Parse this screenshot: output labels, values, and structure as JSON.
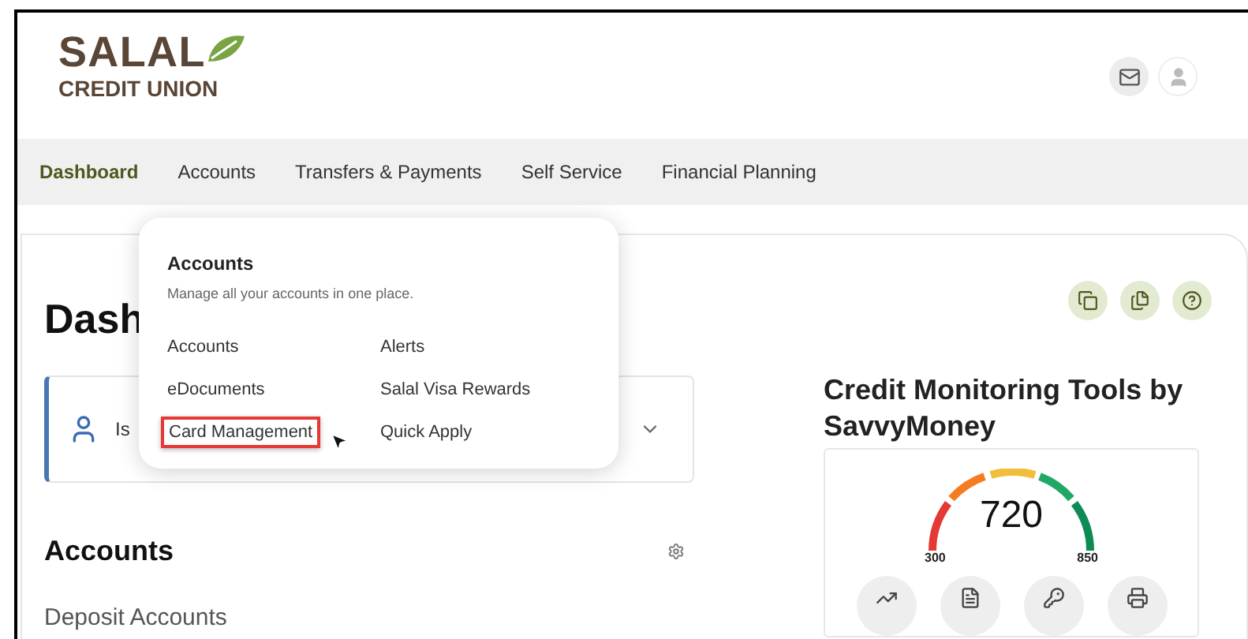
{
  "logo": {
    "name": "SALAL",
    "subtitle": "CREDIT UNION"
  },
  "nav": [
    {
      "label": "Dashboard",
      "selected": true
    },
    {
      "label": "Accounts",
      "selected": false
    },
    {
      "label": "Transfers & Payments",
      "selected": false
    },
    {
      "label": "Self Service",
      "selected": false
    },
    {
      "label": "Financial Planning",
      "selected": false
    }
  ],
  "dropdown": {
    "title": "Accounts",
    "description": "Manage all your accounts in one place.",
    "items": [
      {
        "label": "Accounts",
        "highlighted": false
      },
      {
        "label": "Alerts",
        "highlighted": false
      },
      {
        "label": "eDocuments",
        "highlighted": false
      },
      {
        "label": "Salal Visa Rewards",
        "highlighted": false
      },
      {
        "label": "Card Management",
        "highlighted": true
      },
      {
        "label": "Quick Apply",
        "highlighted": false
      }
    ]
  },
  "page_title": "Dash",
  "notice": {
    "text": "Is"
  },
  "accounts": {
    "title": "Accounts",
    "group": "Deposit Accounts"
  },
  "credit": {
    "title": "Credit Monitoring Tools by SavvyMoney",
    "score": "720",
    "min": "300",
    "max": "850"
  }
}
